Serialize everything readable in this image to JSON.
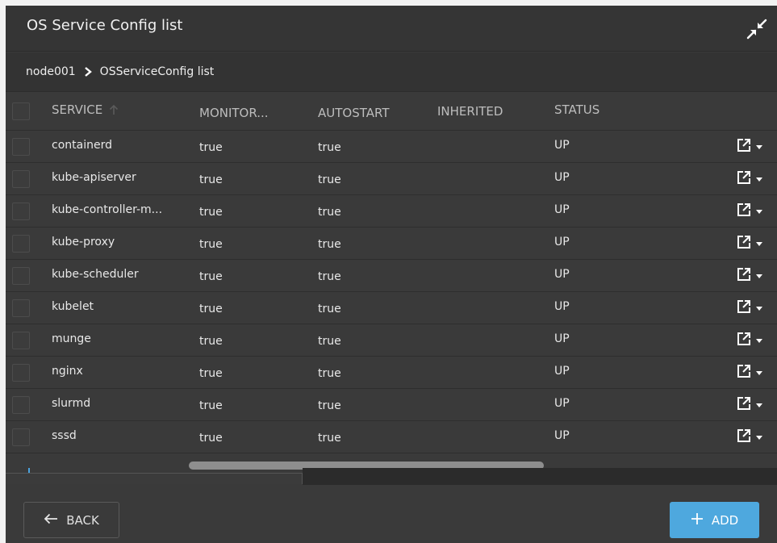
{
  "window": {
    "title": "OS Service Config list"
  },
  "breadcrumb": {
    "parent": "node001",
    "current": "OSServiceConfig list"
  },
  "table": {
    "columns": [
      "SERVICE",
      "MONITOR...",
      "AUTOSTART",
      "INHERITED",
      "STATUS"
    ],
    "rows": [
      {
        "service": "containerd",
        "monitor": "true",
        "autostart": "true",
        "inherited": "",
        "status": "UP"
      },
      {
        "service": "kube-apiserver",
        "monitor": "true",
        "autostart": "true",
        "inherited": "",
        "status": "UP"
      },
      {
        "service": "kube-controller-m...",
        "monitor": "true",
        "autostart": "true",
        "inherited": "",
        "status": "UP"
      },
      {
        "service": "kube-proxy",
        "monitor": "true",
        "autostart": "true",
        "inherited": "",
        "status": "UP"
      },
      {
        "service": "kube-scheduler",
        "monitor": "true",
        "autostart": "true",
        "inherited": "",
        "status": "UP"
      },
      {
        "service": "kubelet",
        "monitor": "true",
        "autostart": "true",
        "inherited": "",
        "status": "UP"
      },
      {
        "service": "munge",
        "monitor": "true",
        "autostart": "true",
        "inherited": "",
        "status": "UP"
      },
      {
        "service": "nginx",
        "monitor": "true",
        "autostart": "true",
        "inherited": "",
        "status": "UP"
      },
      {
        "service": "slurmd",
        "monitor": "true",
        "autostart": "true",
        "inherited": "",
        "status": "UP"
      },
      {
        "service": "sssd",
        "monitor": "true",
        "autostart": "true",
        "inherited": "",
        "status": "UP"
      }
    ]
  },
  "footer": {
    "back_label": "BACK",
    "add_label": "ADD"
  },
  "icons": {
    "collapse": "collapse-arrows-icon",
    "breadcrumb_separator": "chevron-right-icon",
    "sort": "arrow-up-icon",
    "row_open": "open-external-icon",
    "row_menu": "caret-down-icon",
    "back": "arrow-left-icon",
    "add": "plus-icon"
  },
  "colors": {
    "accent": "#4ea8de",
    "background": "#3a3a3a"
  }
}
